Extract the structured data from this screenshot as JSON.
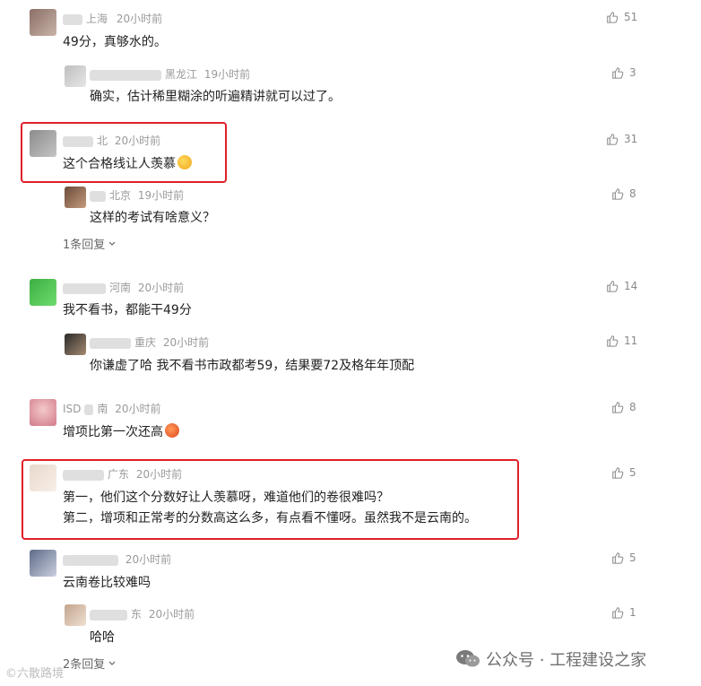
{
  "comments": [
    {
      "id": "c1",
      "location": "上海",
      "time": "20小时前",
      "text": "49分，真够水的。",
      "likes": "51"
    },
    {
      "id": "r1",
      "location": "黑龙江",
      "time": "19小时前",
      "text": "确实，估计稀里糊涂的听遍精讲就可以过了。",
      "likes": "3"
    },
    {
      "id": "c2",
      "location": "北",
      "time": "20小时前",
      "text": "这个合格线让人羡慕",
      "likes": "31"
    },
    {
      "id": "r2",
      "location": "北京",
      "time": "19小时前",
      "text": "这样的考试有啥意义？",
      "likes": "8"
    },
    {
      "id": "c3",
      "location": "河南",
      "time": "20小时前",
      "text": "我不看书，都能干49分",
      "likes": "14"
    },
    {
      "id": "r3",
      "location": "重庆",
      "time": "20小时前",
      "text": "你谦虚了哈 我不看书市政都考59，结果要72及格年年顶配",
      "likes": "11"
    },
    {
      "id": "c4",
      "location": "南",
      "time": "20小时前",
      "name_visible": "ISD",
      "text": "增项比第一次还高",
      "likes": "8"
    },
    {
      "id": "c5",
      "location": "广东",
      "time": "20小时前",
      "text_line1": "第一，他们这个分数好让人羡慕呀，难道他们的卷很难吗？",
      "text_line2": "第二，增项和正常考的分数高这么多，有点看不懂呀。虽然我不是云南的。",
      "likes": "5"
    },
    {
      "id": "c6",
      "location": "",
      "time": "20小时前",
      "text": "云南卷比较难吗",
      "likes": "5"
    },
    {
      "id": "r6",
      "location": "东",
      "time": "20小时前",
      "text": "哈哈",
      "likes": "1"
    }
  ],
  "reply_links": {
    "c2": "1条回复",
    "c6": "2条回复"
  },
  "watermark": {
    "label": "公众号 · 工程建设之家",
    "corner": "©六散路境"
  },
  "colors": {
    "highlight": "#e0202a",
    "meta": "#9a9a9a",
    "text": "#222222"
  }
}
